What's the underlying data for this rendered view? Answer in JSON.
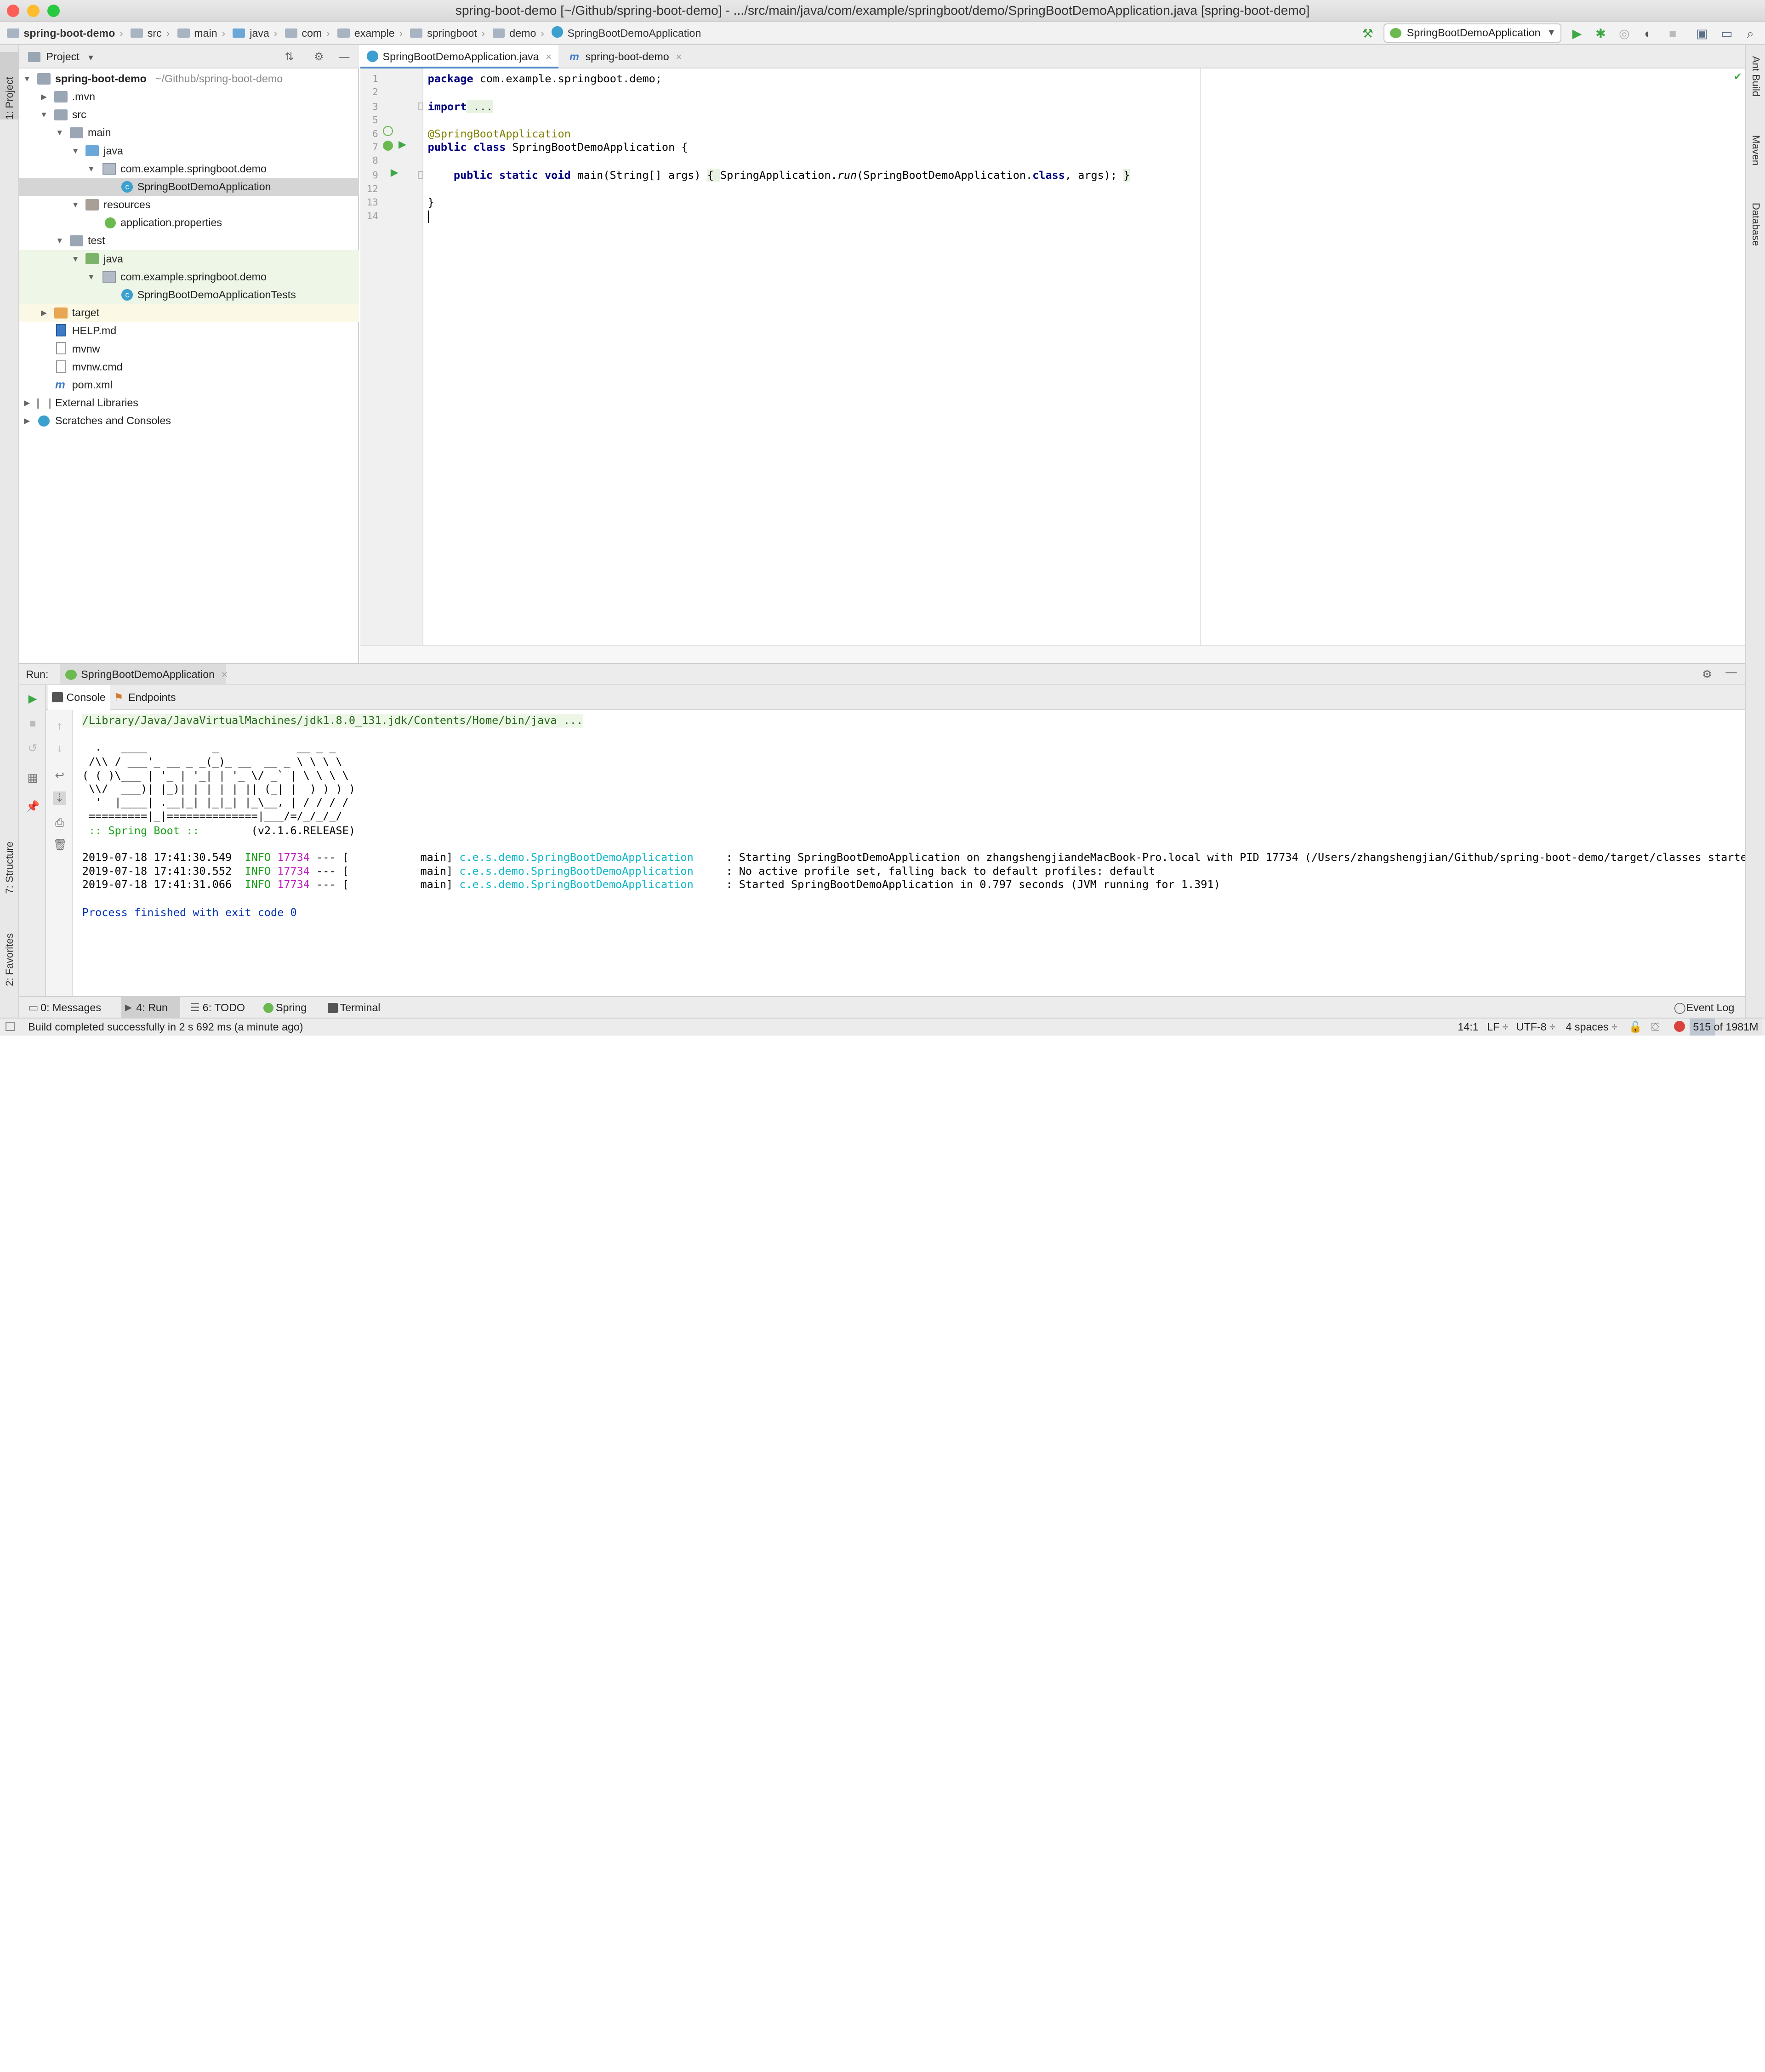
{
  "window": {
    "title": "spring-boot-demo [~/Github/spring-boot-demo] - .../src/main/java/com/example/springboot/demo/SpringBootDemoApplication.java [spring-boot-demo]"
  },
  "breadcrumb": [
    "spring-boot-demo",
    "src",
    "main",
    "java",
    "com",
    "example",
    "springboot",
    "demo",
    "SpringBootDemoApplication"
  ],
  "toolbar": {
    "run_config": "SpringBootDemoApplication"
  },
  "left_stripe": {
    "project": "1: Project",
    "structure": "7: Structure",
    "favorites": "2: Favorites"
  },
  "right_stripe": {
    "ant": "Ant Build",
    "maven": "Maven",
    "database": "Database"
  },
  "project_panel": {
    "title": "Project",
    "tree": [
      {
        "label": "spring-boot-demo",
        "path": "~/Github/spring-boot-demo"
      },
      {
        "label": ".mvn"
      },
      {
        "label": "src"
      },
      {
        "label": "main"
      },
      {
        "label": "java"
      },
      {
        "label": "com.example.springboot.demo"
      },
      {
        "label": "SpringBootDemoApplication"
      },
      {
        "label": "resources"
      },
      {
        "label": "application.properties"
      },
      {
        "label": "test"
      },
      {
        "label": "java"
      },
      {
        "label": "com.example.springboot.demo"
      },
      {
        "label": "SpringBootDemoApplicationTests"
      },
      {
        "label": "target"
      },
      {
        "label": "HELP.md"
      },
      {
        "label": "mvnw"
      },
      {
        "label": "mvnw.cmd"
      },
      {
        "label": "pom.xml"
      },
      {
        "label": "External Libraries"
      },
      {
        "label": "Scratches and Consoles"
      }
    ]
  },
  "editor": {
    "tabs": [
      {
        "label": "SpringBootDemoApplication.java"
      },
      {
        "label": "spring-boot-demo"
      }
    ],
    "line_numbers": [
      "1",
      "2",
      "3",
      "5",
      "6",
      "7",
      "8",
      "9",
      "12",
      "13",
      "14"
    ],
    "code": {
      "l1_kw": "package",
      "l1_rest": " com.example.springboot.demo;",
      "l3_kw": "import",
      "l3_rest": " ...",
      "l6": "@SpringBootApplication",
      "l7_kw": "public class",
      "l7_rest": " SpringBootDemoApplication {",
      "l9_kw": "public static void",
      "l9_a": " main(String[] args) ",
      "l9_b": "{ ",
      "l9_c": "SpringApplication.",
      "l9_d": "run",
      "l9_e": "(SpringBootDemoApplication.",
      "l9_f": "class",
      "l9_g": ", args); ",
      "l9_h": "}",
      "l13": "}"
    }
  },
  "run_panel": {
    "label": "Run:",
    "config": "SpringBootDemoApplication",
    "tabs": [
      "Console",
      "Endpoints"
    ],
    "console": {
      "cmd": "/Library/Java/JavaVirtualMachines/jdk1.8.0_131.jdk/Contents/Home/bin/java ...",
      "banner": [
        "  .   ____          _            __ _ _",
        " /\\\\ / ___'_ __ _ _(_)_ __  __ _ \\ \\ \\ \\",
        "( ( )\\___ | '_ | '_| | '_ \\/ _` | \\ \\ \\ \\",
        " \\\\/  ___)| |_)| | | | | || (_| |  ) ) ) )",
        "  '  |____| .__|_| |_|_| |_\\__, | / / / /",
        " =========|_|==============|___/=/_/_/_/"
      ],
      "boot_label": " :: Spring Boot :: ",
      "boot_version": "       (v2.1.6.RELEASE)",
      "logs": [
        {
          "ts": "2019-07-18 17:41:30.549",
          "level": "INFO",
          "pid": "17734",
          "thread": " --- [           main] ",
          "logger": "c.e.s.demo.SpringBootDemoApplication",
          "msg": "     : Starting SpringBootDemoApplication on zhangshengjiandeMacBook-Pro.local with PID 17734 (/Users/zhangshengjian/Github/spring-boot-demo/target/classes started b"
        },
        {
          "ts": "2019-07-18 17:41:30.552",
          "level": "INFO",
          "pid": "17734",
          "thread": " --- [           main] ",
          "logger": "c.e.s.demo.SpringBootDemoApplication",
          "msg": "     : No active profile set, falling back to default profiles: default"
        },
        {
          "ts": "2019-07-18 17:41:31.066",
          "level": "INFO",
          "pid": "17734",
          "thread": " --- [           main] ",
          "logger": "c.e.s.demo.SpringBootDemoApplication",
          "msg": "     : Started SpringBootDemoApplication in 0.797 seconds (JVM running for 1.391)"
        }
      ],
      "exit": "Process finished with exit code 0"
    }
  },
  "bottom_tabs": {
    "messages": "0: Messages",
    "run": "4: Run",
    "todo": "6: TODO",
    "spring": "Spring",
    "terminal": "Terminal",
    "event_log": "Event Log"
  },
  "status": {
    "message": "Build completed successfully in 2 s 692 ms (a minute ago)",
    "position": "14:1",
    "line_sep": "LF ÷",
    "encoding": "UTF-8 ÷",
    "indent": "4 spaces ÷",
    "memory": "515 of 1981M"
  }
}
